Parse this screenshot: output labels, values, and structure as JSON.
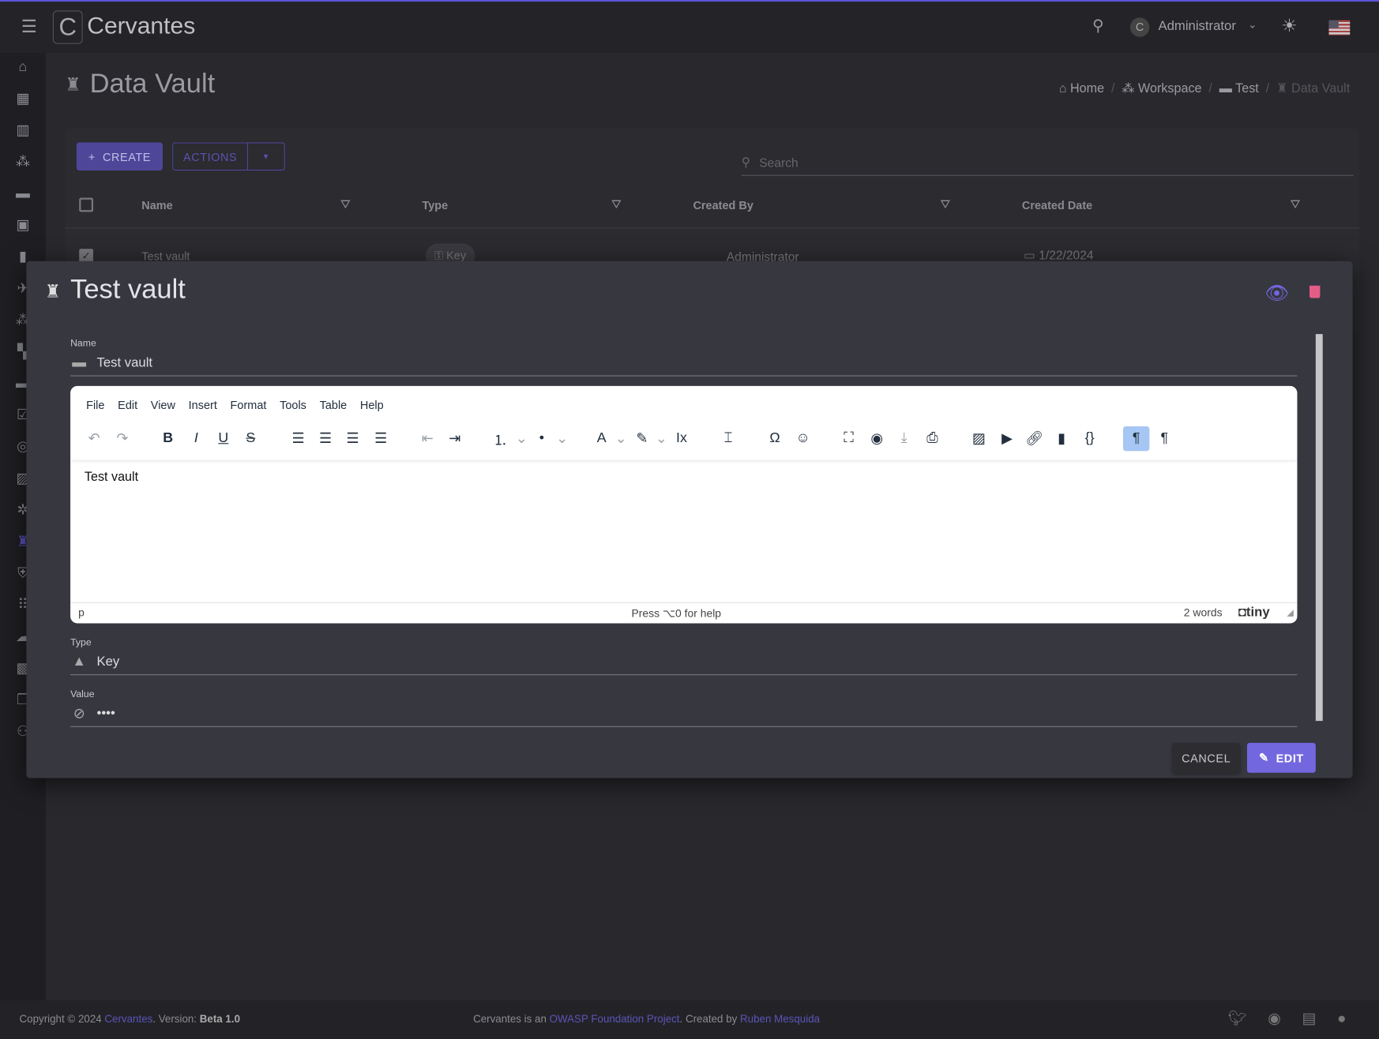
{
  "app": {
    "name": "Cervantes",
    "user": "Administrator"
  },
  "page": {
    "title": "Data Vault",
    "breadcrumb": [
      "Home",
      "Workspace",
      "Test",
      "Data Vault"
    ]
  },
  "toolbar": {
    "create": "CREATE",
    "actions": "ACTIONS",
    "search_placeholder": "Search"
  },
  "table": {
    "columns": [
      "Name",
      "Type",
      "Created By",
      "Created Date"
    ],
    "rows": [
      {
        "name": "Test vault",
        "type": "Key",
        "created_by": "Administrator",
        "created_date": "1/22/2024",
        "checked": true
      }
    ]
  },
  "sidebar": {
    "icons": [
      "home-icon",
      "calendar-icon",
      "book-icon",
      "workspace-icon",
      "folder-icon",
      "briefcase-icon",
      "document-icon",
      "bird-icon",
      "workspace-icon",
      "dashboard-icon",
      "folder-icon",
      "checklist-icon",
      "target-icon",
      "task-icon",
      "bug-icon",
      "vault-icon",
      "shield-icon",
      "apps-icon",
      "cloud-upload-icon",
      "badge-icon",
      "copy-icon",
      "users-icon"
    ],
    "active": "vault-icon"
  },
  "modal": {
    "title": "Test vault",
    "name_label": "Name",
    "name_value": "Test vault",
    "editor": {
      "menu": [
        "File",
        "Edit",
        "View",
        "Insert",
        "Format",
        "Tools",
        "Table",
        "Help"
      ],
      "content": "Test vault",
      "path": "p",
      "help": "Press ⌥0 for help",
      "words": "2 words",
      "brand": "tiny"
    },
    "type_label": "Type",
    "type_value": "Key",
    "value_label": "Value",
    "value_value": "••••",
    "cancel": "CANCEL",
    "edit": "EDIT"
  },
  "footer": {
    "copyright": "Copyright © 2024 ",
    "brand_link": "Cervantes",
    "version_prefix": ". Version: ",
    "version": "Beta 1.0",
    "mid_prefix": "Cervantes is an ",
    "owasp_link": "OWASP Foundation Project",
    "mid_suffix": ". Created by ",
    "author_link": "Ruben Mesquida"
  },
  "colors": {
    "accent": "#7367e0",
    "danger": "#e35d86",
    "modal_bg": "#373740"
  }
}
